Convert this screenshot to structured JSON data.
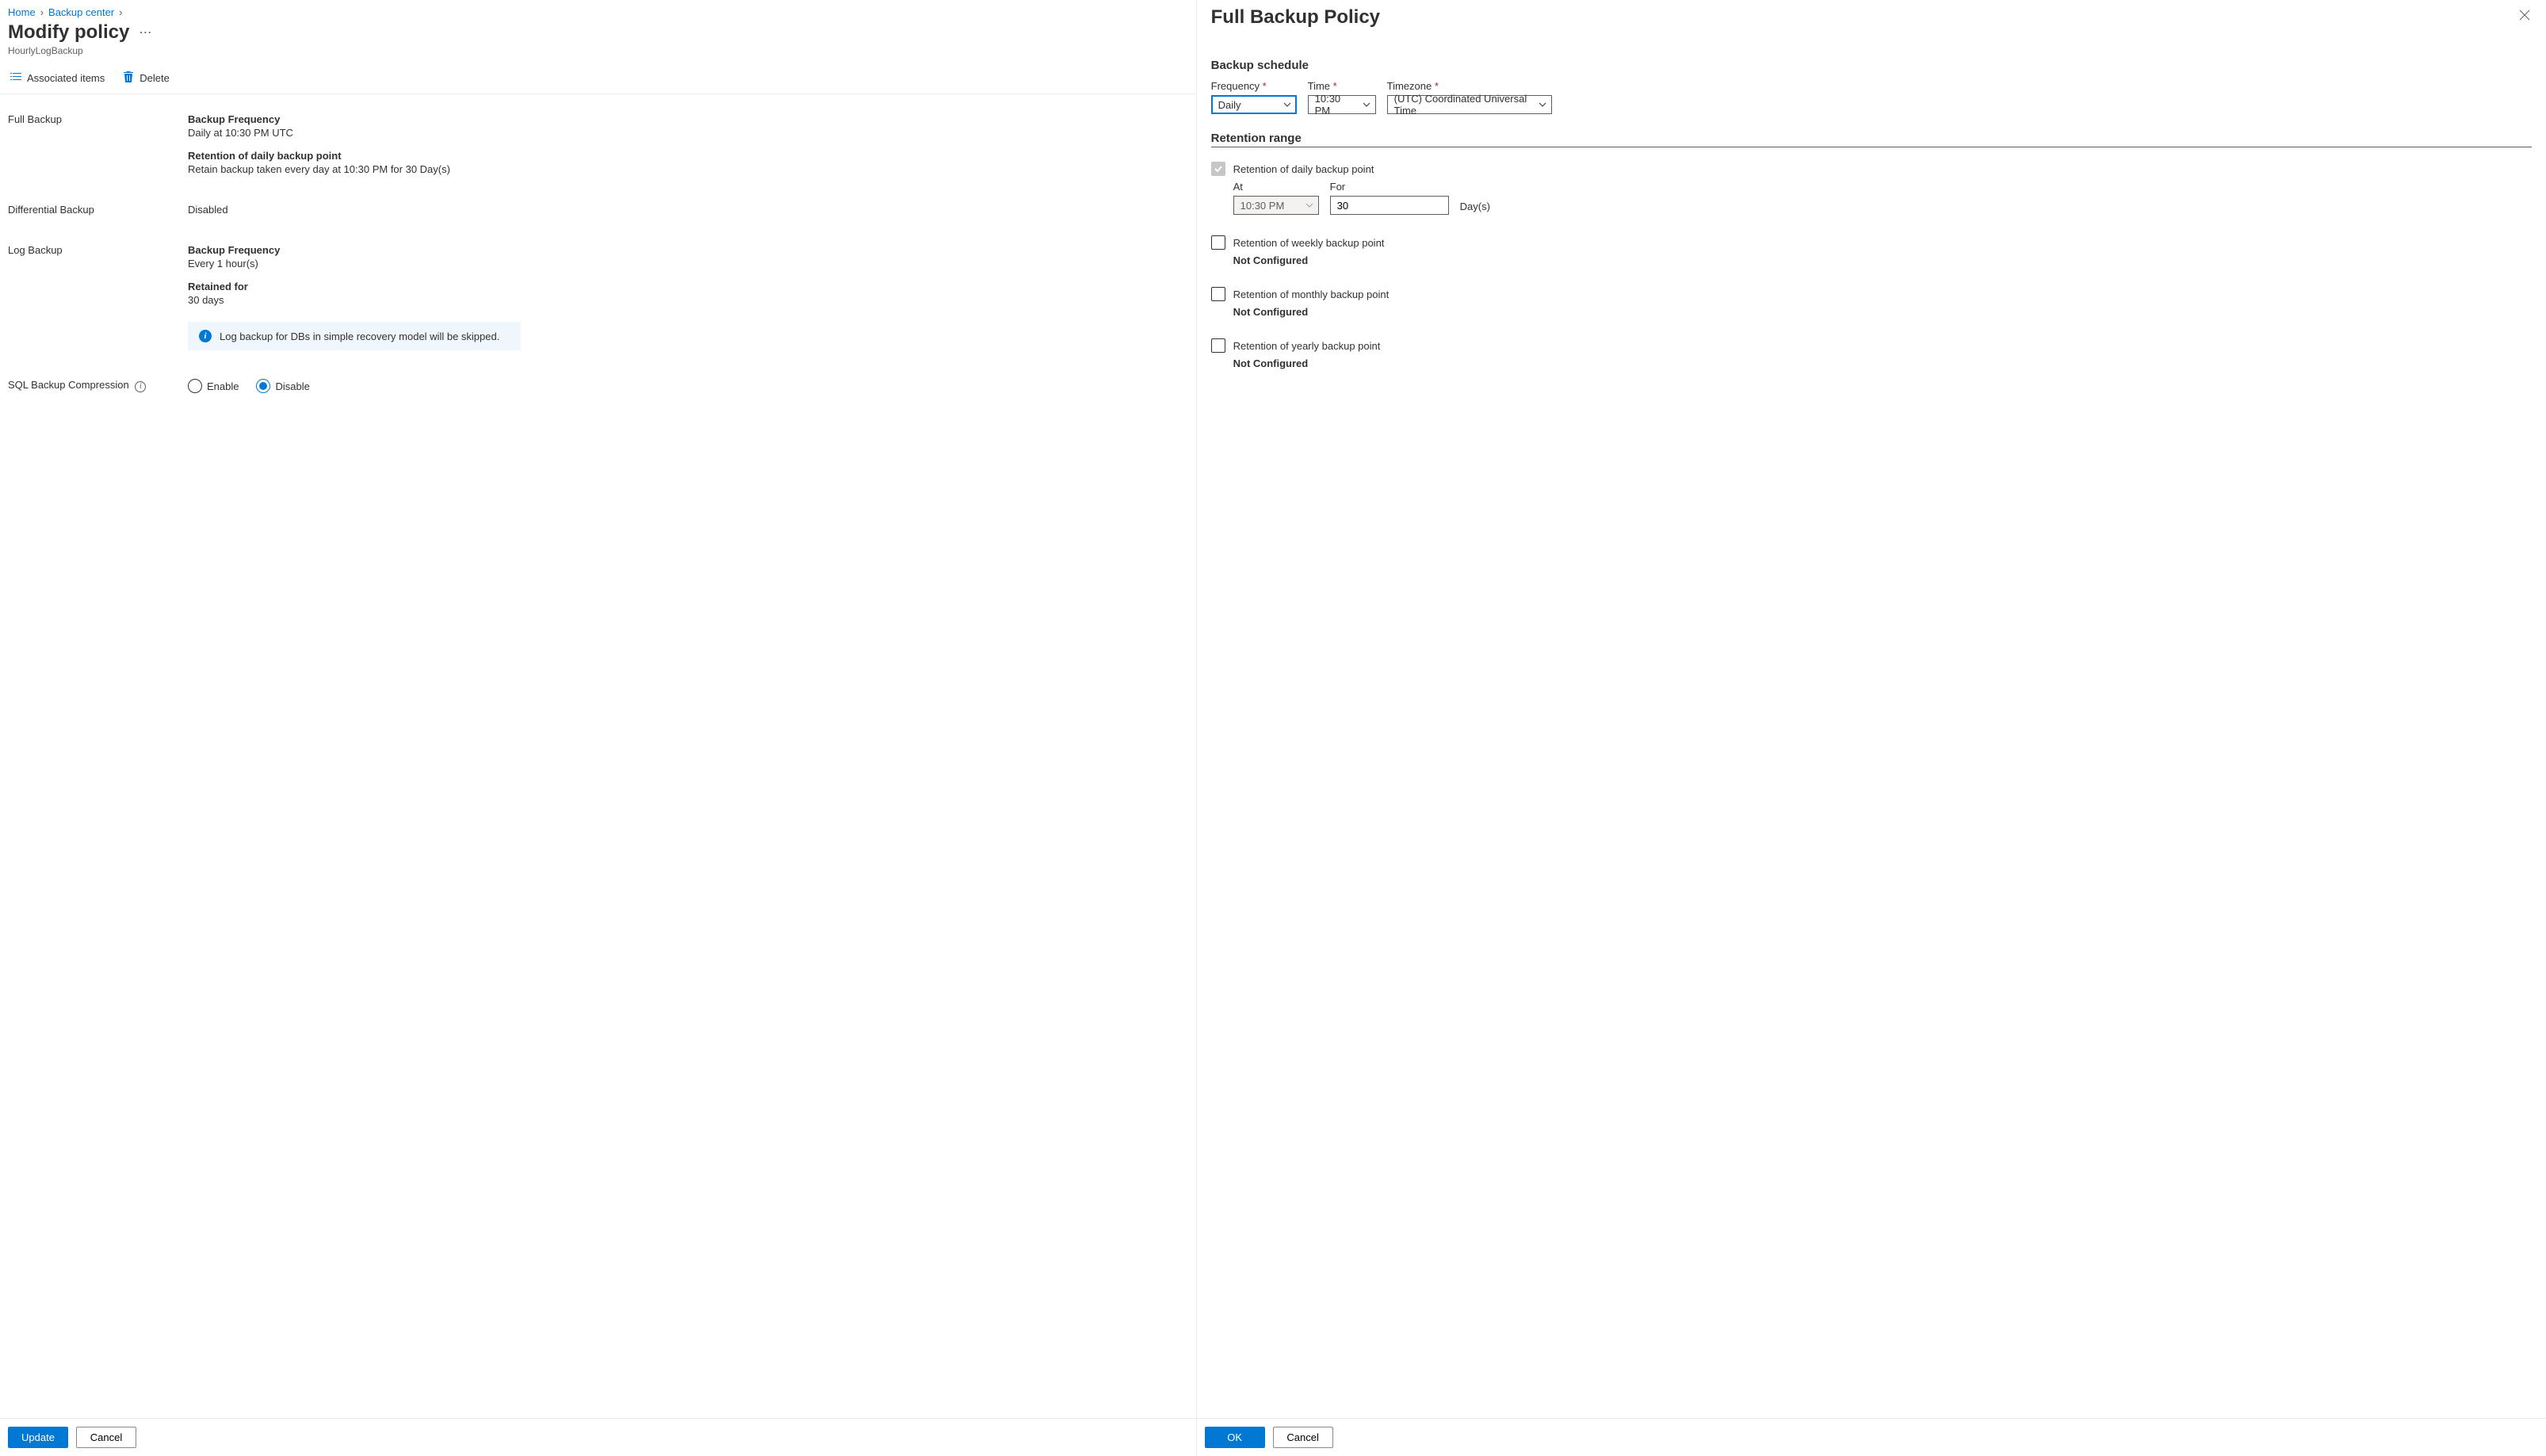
{
  "breadcrumb": {
    "home": "Home",
    "backup_center": "Backup center"
  },
  "page": {
    "title": "Modify policy",
    "subtitle": "HourlyLogBackup"
  },
  "commands": {
    "associated_items": "Associated items",
    "delete": "Delete"
  },
  "full_backup": {
    "section_label": "Full Backup",
    "freq_title": "Backup Frequency",
    "freq_text": "Daily at 10:30 PM UTC",
    "retention_title": "Retention of daily backup point",
    "retention_text": "Retain backup taken every day at 10:30 PM for 30 Day(s)"
  },
  "diff_backup": {
    "section_label": "Differential Backup",
    "status": "Disabled"
  },
  "log_backup": {
    "section_label": "Log Backup",
    "freq_title": "Backup Frequency",
    "freq_text": "Every 1 hour(s)",
    "retained_title": "Retained for",
    "retained_text": "30 days",
    "info": "Log backup for DBs in simple recovery model will be skipped."
  },
  "compression": {
    "section_label": "SQL Backup Compression",
    "enable": "Enable",
    "disable": "Disable"
  },
  "footer": {
    "update": "Update",
    "cancel": "Cancel"
  },
  "panel": {
    "title": "Full Backup Policy",
    "schedule_header": "Backup schedule",
    "frequency_label": "Frequency",
    "frequency_value": "Daily",
    "time_label": "Time",
    "time_value": "10:30 PM",
    "timezone_label": "Timezone",
    "timezone_value": "(UTC) Coordinated Universal Time",
    "retention_header": "Retention range",
    "daily": {
      "label": "Retention of daily backup point",
      "at_label": "At",
      "at_value": "10:30 PM",
      "for_label": "For",
      "for_value": "30",
      "unit": "Day(s)"
    },
    "weekly": {
      "label": "Retention of weekly backup point",
      "status": "Not Configured"
    },
    "monthly": {
      "label": "Retention of monthly backup point",
      "status": "Not Configured"
    },
    "yearly": {
      "label": "Retention of yearly backup point",
      "status": "Not Configured"
    },
    "ok": "OK",
    "cancel": "Cancel"
  }
}
